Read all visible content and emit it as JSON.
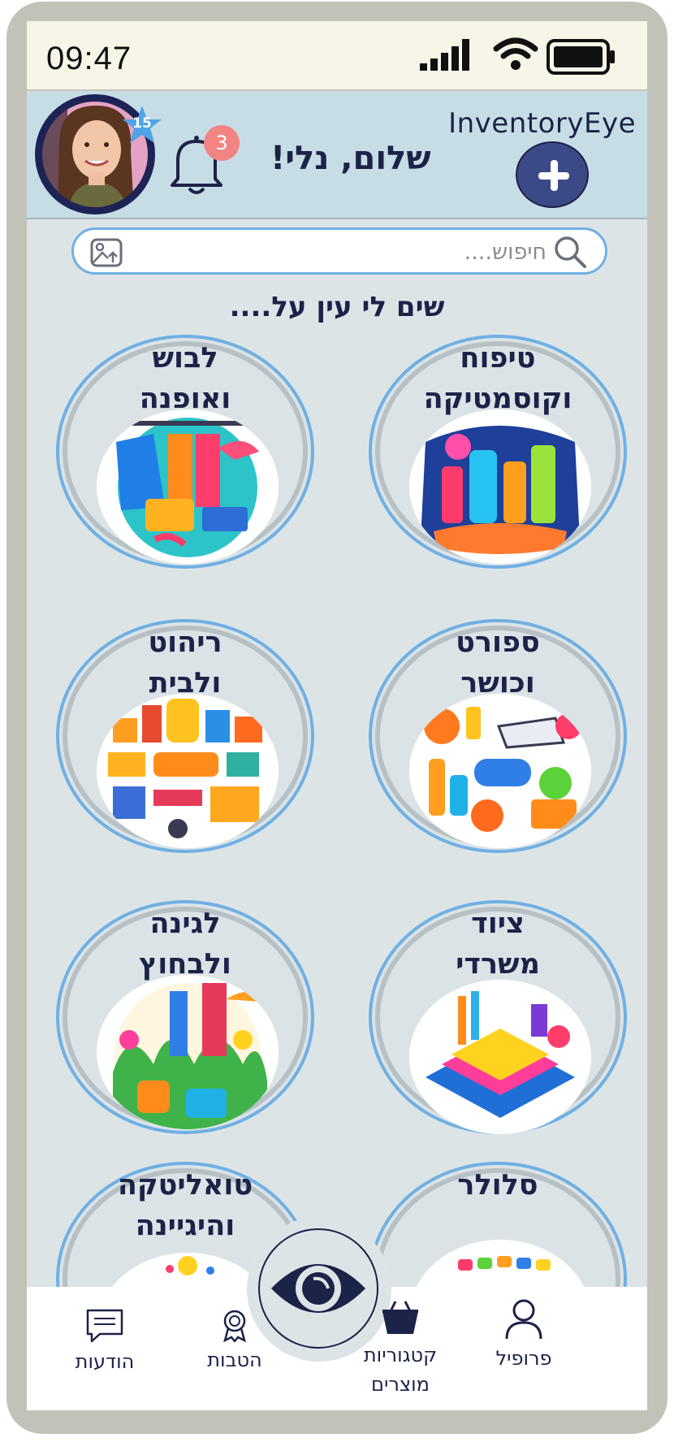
{
  "status_bar": {
    "time": "09:47"
  },
  "header": {
    "app_title": "InventoryEye",
    "greeting": "שלום, נלי!",
    "notification_count": "3",
    "user_level": "15"
  },
  "search": {
    "placeholder": "חיפוש...."
  },
  "section_title": "שים לי עין על....",
  "categories": [
    {
      "line1": "טיפוח",
      "line2": "וקוסמטיקה"
    },
    {
      "line1": "לבוש",
      "line2": "ואופנה"
    },
    {
      "line1": "ספורט",
      "line2": "וכושר"
    },
    {
      "line1": "ריהוט",
      "line2": "ולבית"
    },
    {
      "line1": "ציוד",
      "line2": "משרדי"
    },
    {
      "line1": "לגינה",
      "line2": "ולבחוץ"
    },
    {
      "line1": "סלולר",
      "line2": ""
    },
    {
      "line1": "טואליטקה",
      "line2": "והיגיינה"
    }
  ],
  "bottom_nav": {
    "profile": "פרופיל",
    "categories_line1": "קטגוריות",
    "categories_line2": "מוצרים",
    "benefits": "הטבות",
    "messages": "הודעות"
  },
  "colors": {
    "primary": "#1c2248",
    "accent_blue": "#6fb0e4",
    "header_bg": "#c7dde6",
    "badge_red": "#f28484",
    "add_button": "#3b4a86"
  }
}
